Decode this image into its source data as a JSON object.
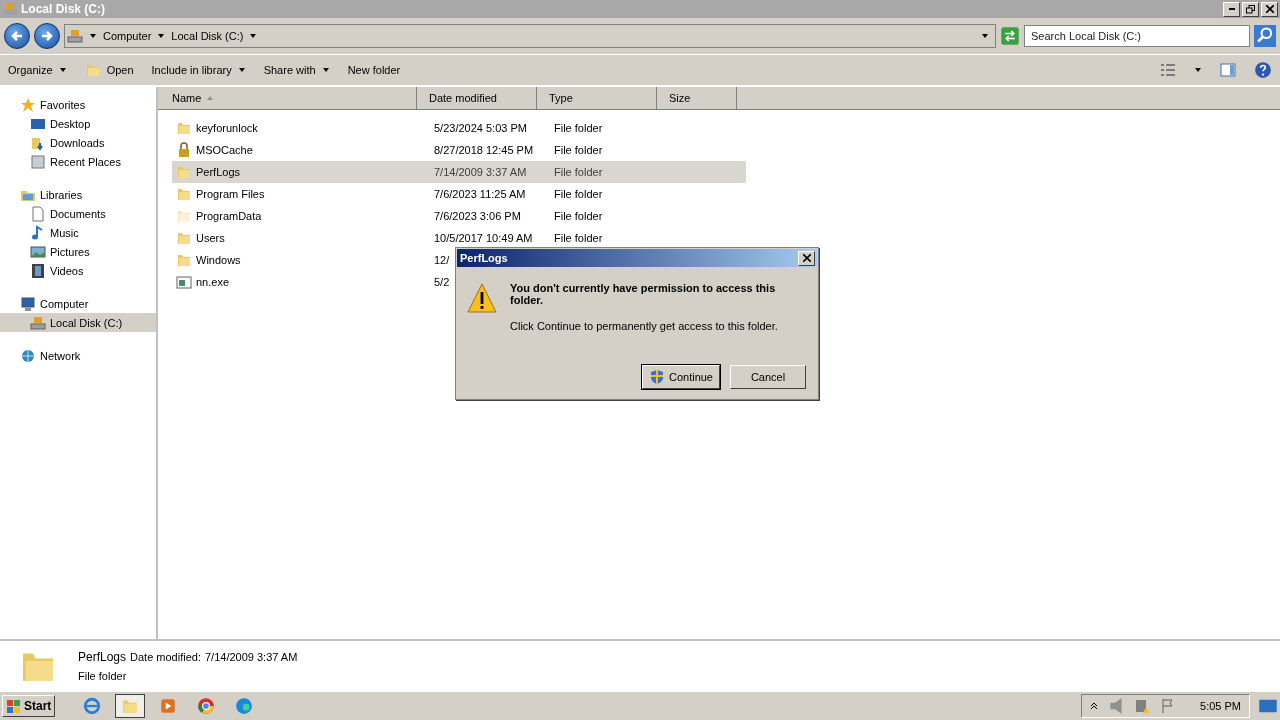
{
  "window": {
    "title": "Local Disk (C:)"
  },
  "address_bar": {
    "crumbs": [
      "Computer",
      "Local Disk (C:)"
    ]
  },
  "search": {
    "placeholder": "Search Local Disk (C:)"
  },
  "toolbar": {
    "items": [
      {
        "label": "Organize",
        "kind": "menu"
      },
      {
        "label": "Open",
        "kind": "icon"
      },
      {
        "label": "Include in library",
        "kind": "menu"
      },
      {
        "label": "Share with",
        "kind": "menu"
      },
      {
        "label": "New folder",
        "kind": "plain"
      }
    ]
  },
  "sidebar": {
    "sections": [
      {
        "label": "Favorites",
        "kind": "star",
        "children": [
          {
            "label": "Desktop",
            "kind": "desktop",
            "selected": false
          },
          {
            "label": "Downloads",
            "kind": "download",
            "selected": false
          },
          {
            "label": "Recent Places",
            "kind": "recent",
            "selected": false
          }
        ]
      },
      {
        "label": "Libraries",
        "kind": "library",
        "children": [
          {
            "label": "Documents",
            "kind": "doc",
            "selected": false
          },
          {
            "label": "Music",
            "kind": "music",
            "selected": false
          },
          {
            "label": "Pictures",
            "kind": "pictures",
            "selected": false
          },
          {
            "label": "Videos",
            "kind": "videos",
            "selected": false
          }
        ]
      },
      {
        "label": "Computer",
        "kind": "computer",
        "children": [
          {
            "label": "Local Disk (C:)",
            "kind": "disk",
            "selected": true
          }
        ]
      },
      {
        "label": "Network",
        "kind": "network"
      }
    ]
  },
  "table": {
    "columns": [
      "Name",
      "Date modified",
      "Type",
      "Size"
    ],
    "rows": [
      {
        "name": "keyforunlock",
        "date": "5/23/2024 5:03 PM",
        "type": "File folder",
        "kind": "folder",
        "selected": false
      },
      {
        "name": "MSOCache",
        "date": "8/27/2018 12:45 PM",
        "type": "File folder",
        "kind": "locked",
        "selected": false
      },
      {
        "name": "PerfLogs",
        "date": "7/14/2009 3:37 AM",
        "type": "File folder",
        "kind": "folder",
        "selected": true
      },
      {
        "name": "Program Files",
        "date": "7/6/2023 11:25 AM",
        "type": "File folder",
        "kind": "folder",
        "selected": false
      },
      {
        "name": "ProgramData",
        "date": "7/6/2023 3:06 PM",
        "type": "File folder",
        "kind": "hidden",
        "selected": false
      },
      {
        "name": "Users",
        "date": "10/5/2017 10:49 AM",
        "type": "File folder",
        "kind": "folder",
        "selected": false
      },
      {
        "name": "Windows",
        "date": "12/",
        "kind": "folder",
        "selected": false
      },
      {
        "name": "nn.exe",
        "date": "5/2",
        "kind": "exe",
        "selected": false
      }
    ]
  },
  "dialog": {
    "title": "PerfLogs",
    "heading": "You don't currently have permission to access this folder.",
    "message": "Click Continue to permanently get access to this folder.",
    "buttons": [
      {
        "label": "Continue",
        "kind": "shield",
        "selected": true
      },
      {
        "label": "Cancel",
        "kind": "plain",
        "selected": false
      }
    ]
  },
  "details": {
    "name": "PerfLogs",
    "date_label": "Date modified:",
    "date": "7/14/2009 3:37 AM",
    "type": "File folder"
  },
  "taskbar": {
    "start": "Start",
    "apps": [
      {
        "kind": "ie",
        "selected": false
      },
      {
        "kind": "explorer",
        "selected": true
      },
      {
        "kind": "media",
        "selected": false
      },
      {
        "kind": "chrome",
        "selected": false
      },
      {
        "kind": "edge",
        "selected": false
      }
    ],
    "clock": "5:05 PM"
  }
}
